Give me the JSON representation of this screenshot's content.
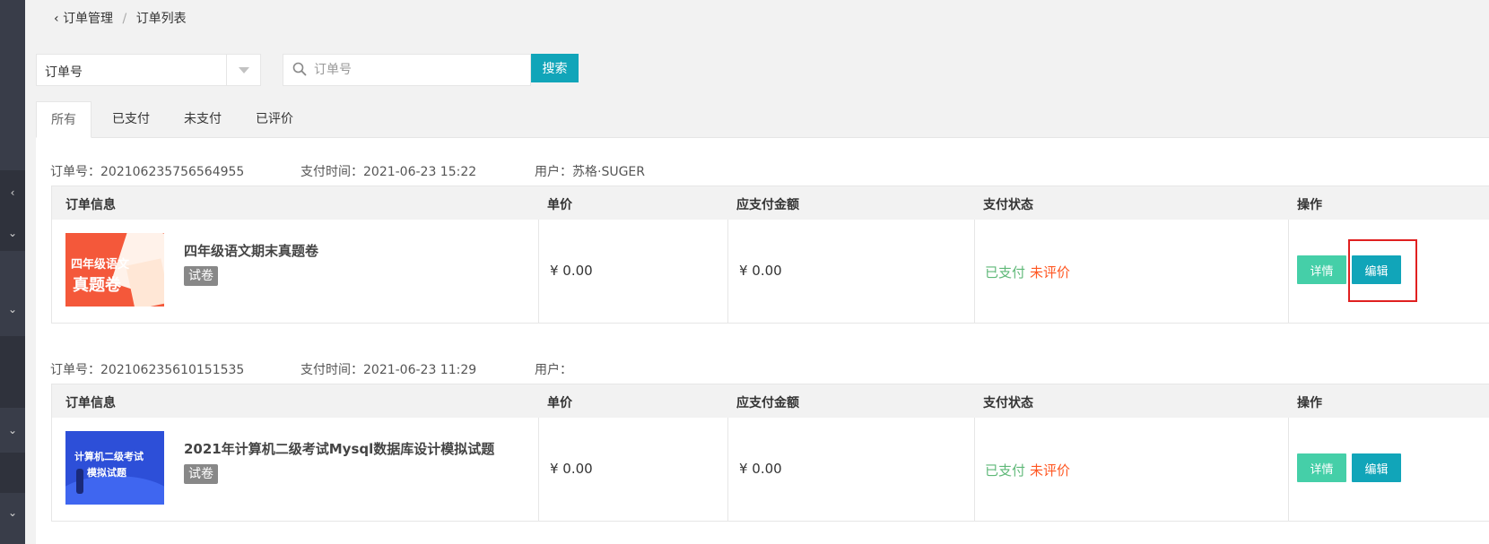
{
  "breadcrumb": {
    "parent": "订单管理",
    "separator": "/",
    "current": "订单列表"
  },
  "filter": {
    "selected": "订单号"
  },
  "search": {
    "placeholder": "订单号",
    "value": "",
    "button_label": "搜索"
  },
  "tabs": [
    {
      "label": "所有",
      "active": true
    },
    {
      "label": "已支付",
      "active": false
    },
    {
      "label": "未支付",
      "active": false
    },
    {
      "label": "已评价",
      "active": false
    }
  ],
  "table_headers": {
    "info": "订单信息",
    "price": "单价",
    "amount": "应支付金额",
    "status": "支付状态",
    "actions": "操作"
  },
  "orders": [
    {
      "order_no_label": "订单号：",
      "order_no": "202106235756564955",
      "paytime_label": "支付时间：",
      "paytime": "2021-06-23 15:22",
      "user_label": "用户：",
      "user": "苏格·SUGER",
      "product_name": "四年级语文期末真题卷",
      "product_tag": "试卷",
      "thumb_text_1": "四年级语文",
      "thumb_text_2": "真题卷",
      "price": "¥ 0.00",
      "amount": "¥ 0.00",
      "paid_status": "已支付",
      "review_status": "未评价",
      "detail_label": "详情",
      "edit_label": "编辑"
    },
    {
      "order_no_label": "订单号：",
      "order_no": "202106235610151535",
      "paytime_label": "支付时间：",
      "paytime": "2021-06-23 11:29",
      "user_label": "用户：",
      "user": "",
      "product_name": "2021年计算机二级考试Mysql数据库设计模拟试题",
      "product_tag": "试卷",
      "thumb_text_1": "计算机二级考试",
      "thumb_text_2": "模拟试题",
      "price": "¥ 0.00",
      "amount": "¥ 0.00",
      "paid_status": "已支付",
      "review_status": "未评价",
      "detail_label": "详情",
      "edit_label": "编辑"
    }
  ],
  "colors": {
    "accent": "#11a5b9",
    "detail": "#45cfa8",
    "paid": "#5fb878",
    "unrated": "#ff5722",
    "highlight": "#e02020"
  }
}
